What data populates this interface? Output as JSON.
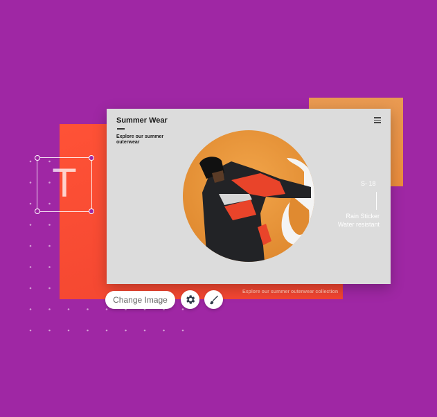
{
  "colors": {
    "background": "#9f27a4",
    "red_panel": "#f04430",
    "orange_panel": "#eb8c3c",
    "card": "#dcdcdc",
    "photo_circle": "#eb9a3a"
  },
  "text_tool": {
    "glyph": "T"
  },
  "card": {
    "title": "Summer Wear",
    "subtitle": "Explore our summer outerwear",
    "menu_icon": "hamburger-icon",
    "size_label": "S- 18",
    "feature_1": "Rain Sticker",
    "feature_2": "Water resistant"
  },
  "red_panel": {
    "caption": "Explore our summer outerwear collection"
  },
  "toolbar": {
    "change_image_label": "Change Image",
    "settings_icon": "gear-icon",
    "edit_icon": "brush-icon"
  }
}
